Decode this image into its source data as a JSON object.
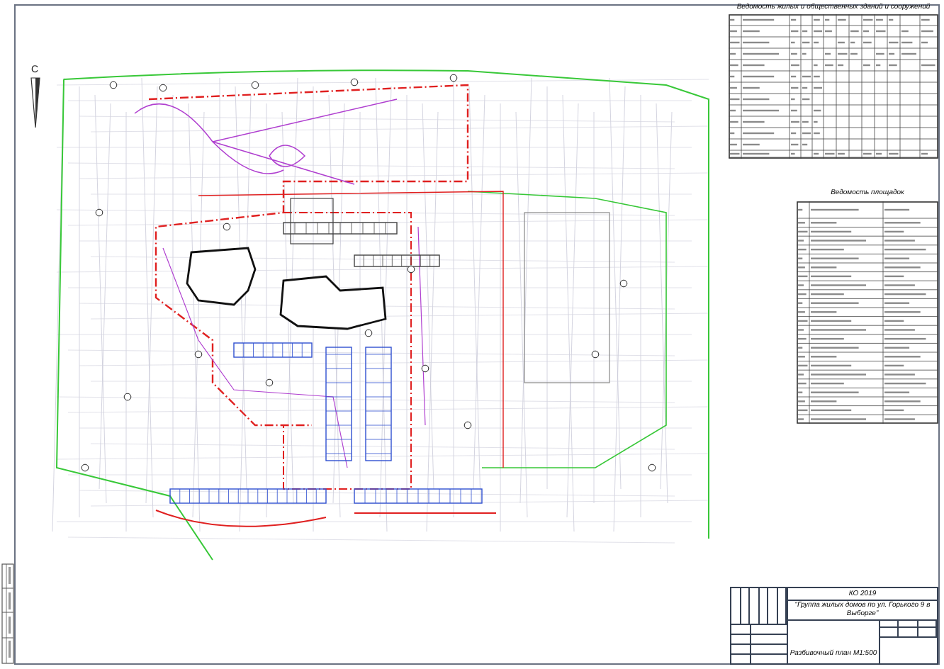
{
  "plan": {
    "north_label": "С"
  },
  "buildings_table": {
    "title": "Ведомость жилых и общественных зданий и сооружений"
  },
  "sites_table": {
    "title": "Ведомость площадок"
  },
  "title_block": {
    "code": "КО 2019",
    "project": "“Группа жилых домов по ул. Горького 9 в Выборге”",
    "sheet_title": "Разбивочный план М1:500"
  }
}
